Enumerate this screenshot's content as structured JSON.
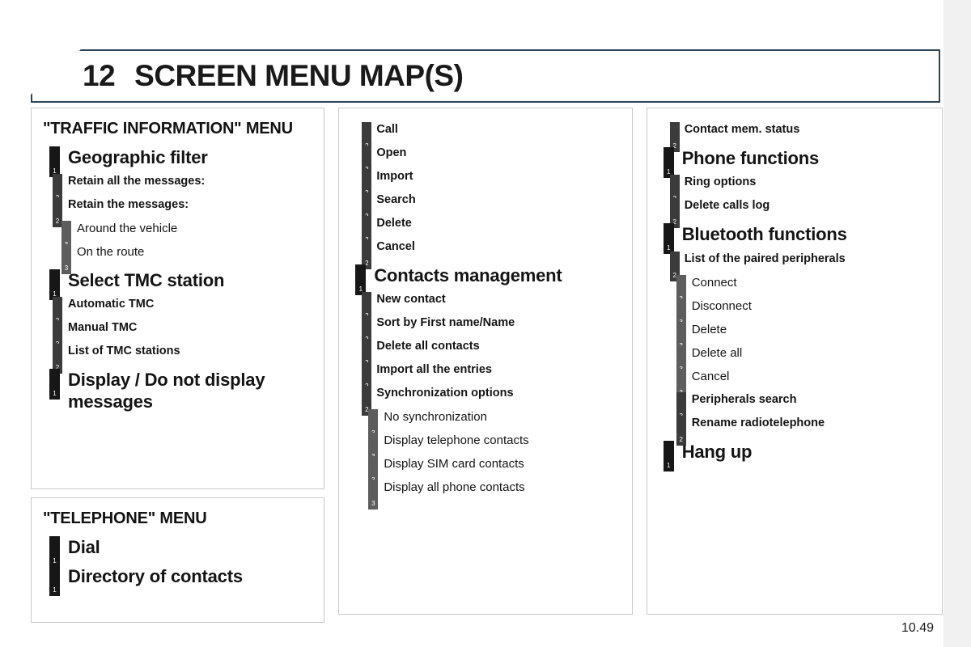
{
  "header": {
    "chapter_number": "12",
    "title": "SCREEN MENU MAP(S)"
  },
  "footer": {
    "page_number": "10.49"
  },
  "colors": {
    "level1_marker": "#171717",
    "level2_marker": "#3b3b3b",
    "level3_marker": "#5d5d5d",
    "header_border": "#2d4356",
    "panel_border": "#c9c9c9",
    "text": "#141414"
  },
  "columns": [
    {
      "panels": [
        {
          "heading": "\"TRAFFIC INFORMATION\" MENU",
          "items": [
            {
              "level": 1,
              "marker": "1",
              "label": "Geographic filter"
            },
            {
              "level": 2,
              "marker": "2",
              "label": "Retain all the messages:"
            },
            {
              "level": 2,
              "marker": "2",
              "label": "Retain the messages:"
            },
            {
              "level": 3,
              "marker": "3",
              "label": "Around the vehicle"
            },
            {
              "level": 3,
              "marker": "3",
              "label": "On the route"
            },
            {
              "level": 1,
              "marker": "1",
              "label": "Select TMC station"
            },
            {
              "level": 2,
              "marker": "2",
              "label": "Automatic TMC"
            },
            {
              "level": 2,
              "marker": "2",
              "label": "Manual TMC"
            },
            {
              "level": 2,
              "marker": "2",
              "label": "List of TMC stations"
            },
            {
              "level": 1,
              "marker": "1",
              "label": "Display / Do not display messages"
            }
          ]
        },
        {
          "heading": "\"TELEPHONE\" MENU",
          "items": [
            {
              "level": 1,
              "marker": "1",
              "label": "Dial"
            },
            {
              "level": 1,
              "marker": "1",
              "label": "Directory of contacts"
            }
          ]
        }
      ]
    },
    {
      "panels": [
        {
          "heading": "",
          "items": [
            {
              "level": 2,
              "marker": "2",
              "label": "Call"
            },
            {
              "level": 2,
              "marker": "2",
              "label": "Open"
            },
            {
              "level": 2,
              "marker": "2",
              "label": "Import"
            },
            {
              "level": 2,
              "marker": "2",
              "label": "Search"
            },
            {
              "level": 2,
              "marker": "2",
              "label": "Delete"
            },
            {
              "level": 2,
              "marker": "2",
              "label": "Cancel"
            },
            {
              "level": 1,
              "marker": "1",
              "label": "Contacts management"
            },
            {
              "level": 2,
              "marker": "2",
              "label": "New contact"
            },
            {
              "level": 2,
              "marker": "2",
              "label": "Sort by First name/Name"
            },
            {
              "level": 2,
              "marker": "2",
              "label": "Delete all contacts"
            },
            {
              "level": 2,
              "marker": "2",
              "label": "Import all the entries"
            },
            {
              "level": 2,
              "marker": "2",
              "label": "Synchronization options"
            },
            {
              "level": 3,
              "marker": "3",
              "label": "No synchronization"
            },
            {
              "level": 3,
              "marker": "3",
              "label": "Display telephone contacts"
            },
            {
              "level": 3,
              "marker": "3",
              "label": "Display SIM card contacts"
            },
            {
              "level": 3,
              "marker": "3",
              "label": "Display all phone contacts"
            }
          ]
        }
      ]
    },
    {
      "panels": [
        {
          "heading": "",
          "items": [
            {
              "level": 2,
              "marker": "2",
              "label": "Contact mem. status"
            },
            {
              "level": 1,
              "marker": "1",
              "label": "Phone functions"
            },
            {
              "level": 2,
              "marker": "2",
              "label": "Ring options"
            },
            {
              "level": 2,
              "marker": "2",
              "label": "Delete calls log"
            },
            {
              "level": 1,
              "marker": "1",
              "label": "Bluetooth functions"
            },
            {
              "level": 2,
              "marker": "2",
              "label": "List of the paired peripherals"
            },
            {
              "level": 3,
              "marker": "3",
              "label": "Connect"
            },
            {
              "level": 3,
              "marker": "3",
              "label": "Disconnect"
            },
            {
              "level": 3,
              "marker": "3",
              "label": "Delete"
            },
            {
              "level": 3,
              "marker": "3",
              "label": "Delete all"
            },
            {
              "level": 3,
              "marker": "3",
              "label": "Cancel"
            },
            {
              "level": 2,
              "marker": "2",
              "label": "Peripherals search",
              "indent": true
            },
            {
              "level": 2,
              "marker": "2",
              "label": "Rename radiotelephone",
              "indent": true
            },
            {
              "level": 1,
              "marker": "1",
              "label": "Hang up"
            }
          ]
        }
      ]
    }
  ]
}
